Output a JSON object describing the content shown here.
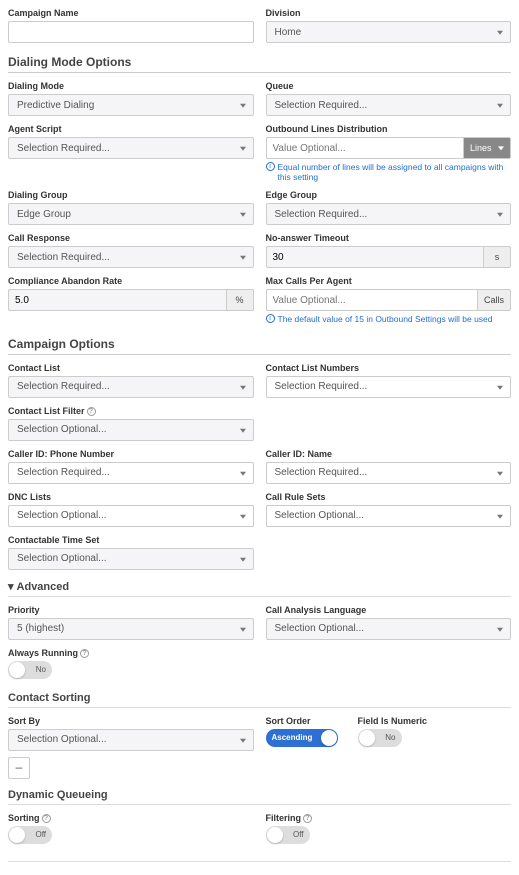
{
  "top": {
    "campaign_name_label": "Campaign Name",
    "campaign_name_value": "",
    "division_label": "Division",
    "division_value": "Home"
  },
  "dialing": {
    "header": "Dialing Mode Options",
    "dialing_mode_label": "Dialing Mode",
    "dialing_mode_value": "Predictive Dialing",
    "queue_label": "Queue",
    "queue_value": "Selection Required...",
    "agent_script_label": "Agent Script",
    "agent_script_value": "Selection Required...",
    "old_label": "Outbound Lines Distribution",
    "old_value": "Value Optional...",
    "old_suffix": "Lines",
    "old_info": "Equal number of lines will be assigned to all campaigns with this setting",
    "dialing_group_label": "Dialing Group",
    "dialing_group_value": "Edge Group",
    "edge_group_label": "Edge Group",
    "edge_group_value": "Selection Required...",
    "call_response_label": "Call Response",
    "call_response_value": "Selection Required...",
    "no_answer_label": "No-answer Timeout",
    "no_answer_value": "30",
    "no_answer_suffix": "s",
    "compliance_label": "Compliance Abandon Rate",
    "compliance_value": "5.0",
    "compliance_suffix": "%",
    "max_calls_label": "Max Calls Per Agent",
    "max_calls_value": "Value Optional...",
    "max_calls_suffix": "Calls",
    "max_calls_info": "The default value of 15 in Outbound Settings will be used"
  },
  "campaign": {
    "header": "Campaign Options",
    "contact_list_label": "Contact List",
    "contact_list_value": "Selection Required...",
    "contact_list_numbers_label": "Contact List Numbers",
    "contact_list_numbers_value": "Selection Required...",
    "contact_list_filter_label": "Contact List Filter",
    "contact_list_filter_value": "Selection Optional...",
    "caller_id_phone_label": "Caller ID: Phone Number",
    "caller_id_phone_value": "Selection Required...",
    "caller_id_name_label": "Caller ID: Name",
    "caller_id_name_value": "Selection Required...",
    "dnc_lists_label": "DNC Lists",
    "dnc_lists_value": "Selection Optional...",
    "call_rule_sets_label": "Call Rule Sets",
    "call_rule_sets_value": "Selection Optional...",
    "contactable_time_set_label": "Contactable Time Set",
    "contactable_time_set_value": "Selection Optional..."
  },
  "advanced": {
    "header": "Advanced",
    "priority_label": "Priority",
    "priority_value": "5 (highest)",
    "call_analysis_lang_label": "Call Analysis Language",
    "call_analysis_lang_value": "Selection Optional...",
    "always_running_label": "Always Running",
    "always_running_value": "No"
  },
  "sorting": {
    "header": "Contact Sorting",
    "sort_by_label": "Sort By",
    "sort_by_value": "Selection Optional...",
    "sort_order_label": "Sort Order",
    "sort_order_value": "Ascending",
    "field_numeric_label": "Field Is Numeric",
    "field_numeric_value": "No",
    "remove_btn": "–"
  },
  "dynamic": {
    "header": "Dynamic Queueing",
    "sorting_label": "Sorting",
    "sorting_value": "Off",
    "filtering_label": "Filtering",
    "filtering_value": "Off"
  }
}
